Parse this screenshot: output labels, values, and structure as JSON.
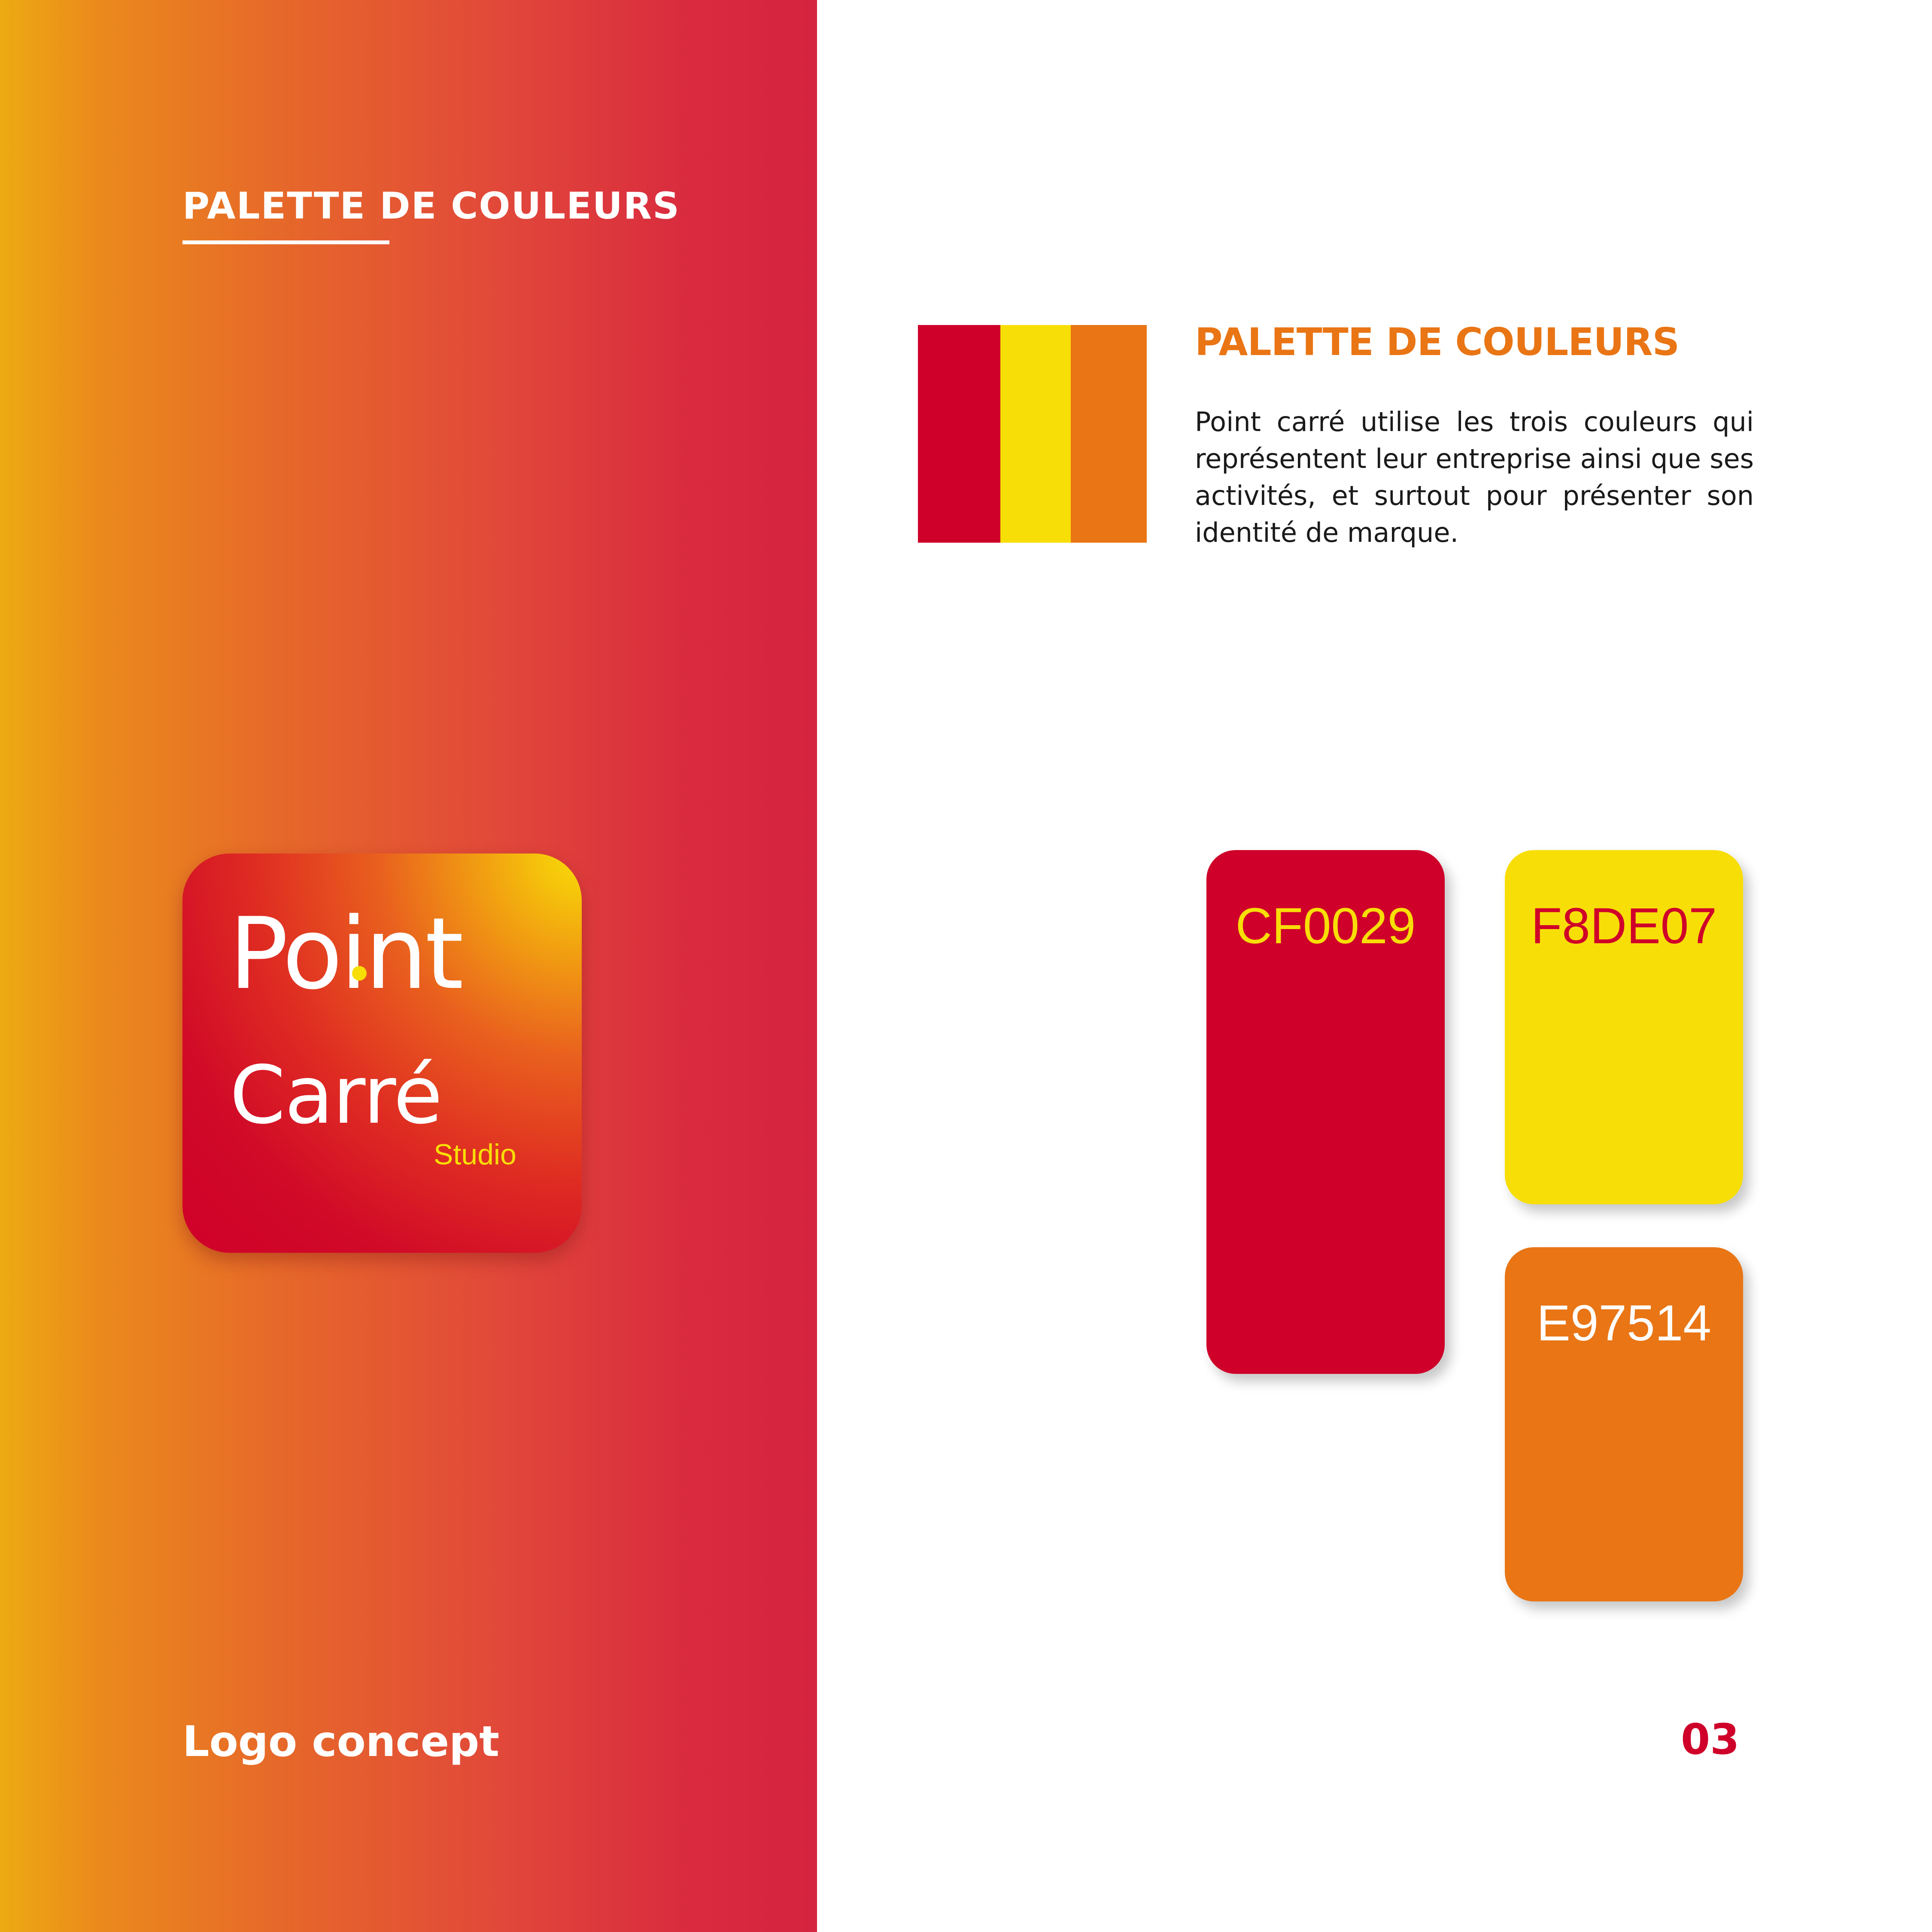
{
  "left_panel": {
    "section_title": "PALETTE DE COULEURS",
    "footer_label": "Logo concept"
  },
  "logo": {
    "word_point": "Point",
    "word_carre": "Carré",
    "word_studio": "Studio"
  },
  "content": {
    "section_title": "PALETTE DE COULEURS",
    "description": "Point carré utilise les trois couleurs qui représentent leur entreprise ainsi que ses activités, et surtout pour présenter son identité de marque."
  },
  "flag_colors": [
    "#CF0029",
    "#F8DE07",
    "#E97514"
  ],
  "swatches": [
    {
      "code": "CF0029",
      "color": "#CF0029",
      "text_color": "#F8DE07"
    },
    {
      "code": "F8DE07",
      "color": "#F8DE07",
      "text_color": "#CF0029"
    },
    {
      "code": "E97514",
      "color": "#E97514",
      "text_color": "#FFFFFF"
    }
  ],
  "page_number": "03"
}
